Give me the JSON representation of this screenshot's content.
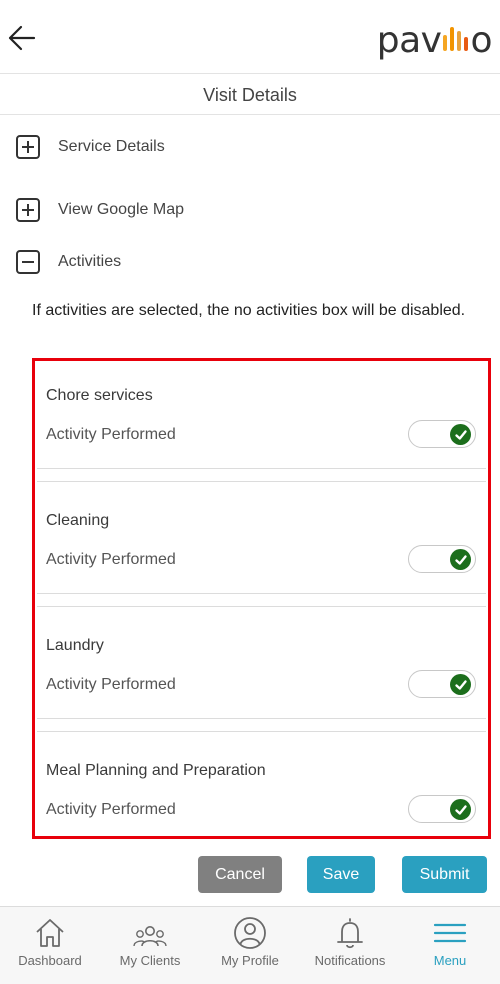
{
  "header": {
    "back_icon": "arrow-left-icon",
    "logo": {
      "text_left": "pav",
      "text_right": "o",
      "bar_colors": [
        "#f5a623",
        "#f29400",
        "#e8a33d",
        "#e85a12"
      ]
    }
  },
  "page_title": "Visit Details",
  "sections": [
    {
      "label": "Service Details",
      "state": "collapsed"
    },
    {
      "label": "View Google Map",
      "state": "collapsed"
    },
    {
      "label": "Activities",
      "state": "expanded"
    }
  ],
  "info_text": "If activities are selected, the no activities box will be disabled.",
  "activities": [
    {
      "name": "Chore services",
      "performed_label": "Activity Performed",
      "performed": true
    },
    {
      "name": "Cleaning",
      "performed_label": "Activity Performed",
      "performed": true
    },
    {
      "name": "Laundry",
      "performed_label": "Activity Performed",
      "performed": true
    },
    {
      "name": "Meal Planning and Preparation",
      "performed_label": "Activity Performed",
      "performed": true
    }
  ],
  "colors": {
    "highlight_border": "#e8000b",
    "accent": "#2aa0c0",
    "toggle_on": "#1c6e1c",
    "cancel": "#808080"
  },
  "buttons": {
    "cancel": "Cancel",
    "save": "Save",
    "submit": "Submit"
  },
  "tabbar": {
    "items": [
      {
        "label": "Dashboard",
        "icon": "house-icon"
      },
      {
        "label": "My Clients",
        "icon": "people-icon"
      },
      {
        "label": "My Profile",
        "icon": "profile-icon"
      },
      {
        "label": "Notifications",
        "icon": "bell-icon"
      },
      {
        "label": "Menu",
        "icon": "hamburger-icon",
        "active": true
      }
    ]
  }
}
